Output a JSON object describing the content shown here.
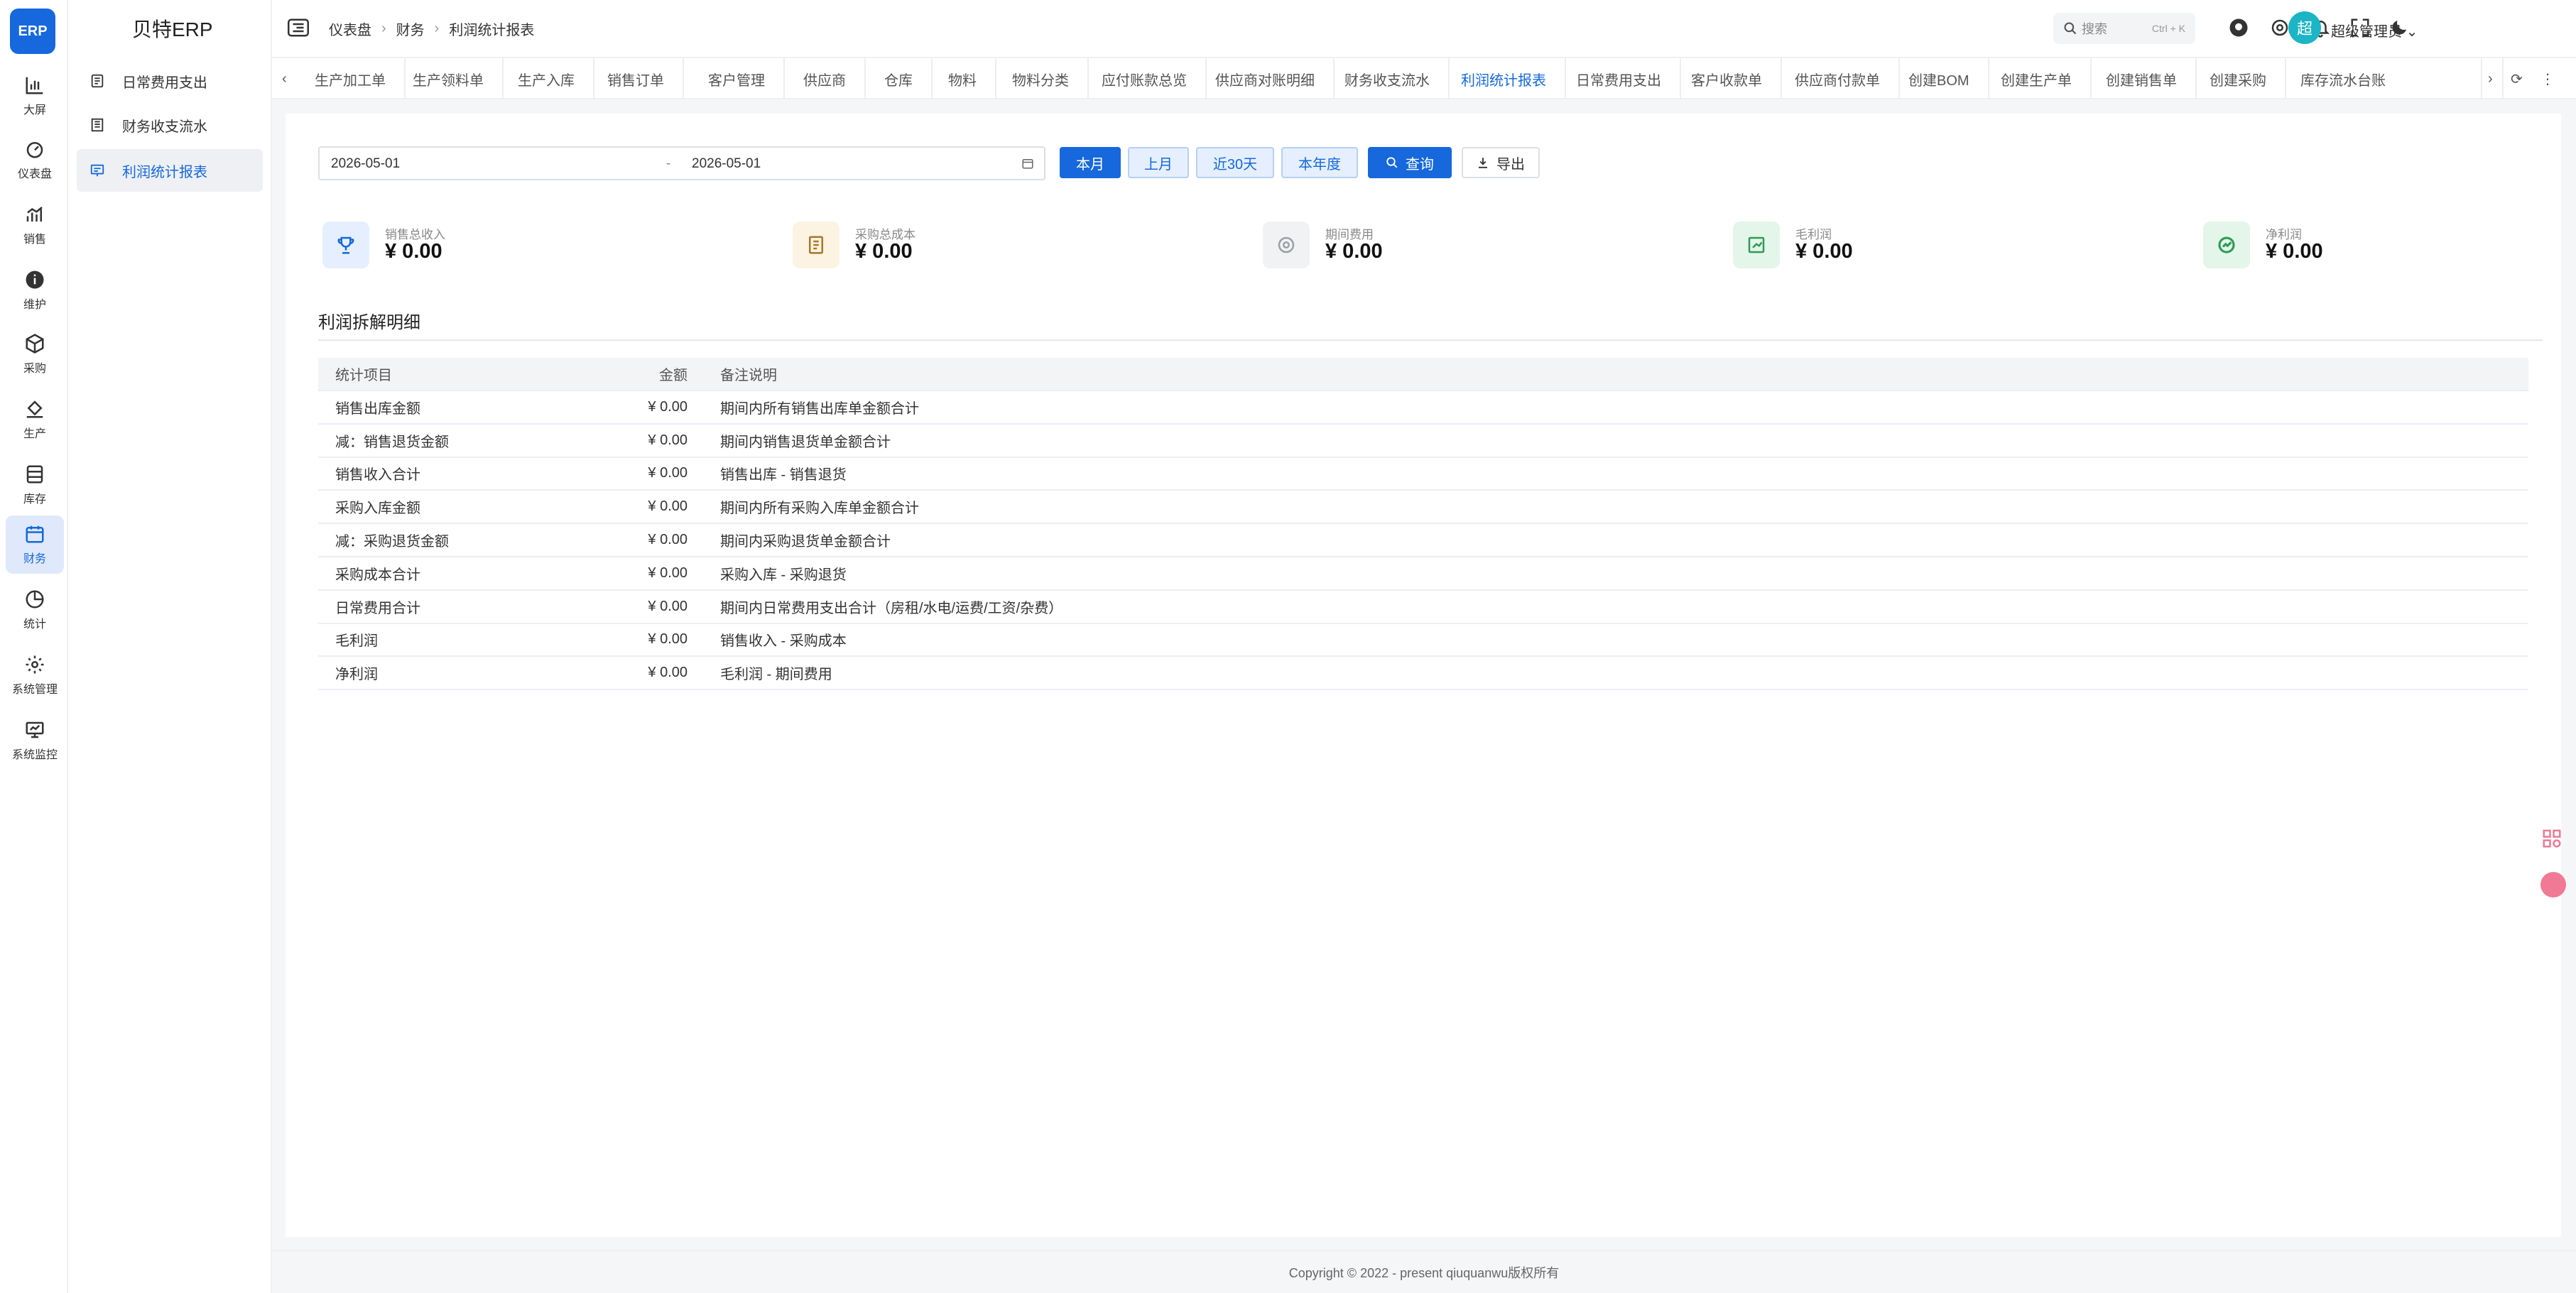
{
  "app": {
    "logo_text": "ERP",
    "brand": "贝特ERP"
  },
  "rail": [
    {
      "label": "大屏",
      "icon": "bar-chart-icon"
    },
    {
      "label": "仪表盘",
      "icon": "dashboard-icon"
    },
    {
      "label": "销售",
      "icon": "trend-chart-icon"
    },
    {
      "label": "维护",
      "icon": "info-icon"
    },
    {
      "label": "采购",
      "icon": "box-icon"
    },
    {
      "label": "生产",
      "icon": "paint-bucket-icon"
    },
    {
      "label": "库存",
      "icon": "storage-icon"
    },
    {
      "label": "财务",
      "icon": "calendar-icon"
    },
    {
      "label": "统计",
      "icon": "pie-chart-icon"
    },
    {
      "label": "系统管理",
      "icon": "gear-icon"
    },
    {
      "label": "系统监控",
      "icon": "monitor-icon"
    }
  ],
  "submenu": [
    {
      "label": "日常费用支出",
      "icon": "expense-icon"
    },
    {
      "label": "财务收支流水",
      "icon": "ledger-icon"
    },
    {
      "label": "利润统计报表",
      "icon": "report-icon"
    }
  ],
  "breadcrumb": [
    "仪表盘",
    "财务",
    "利润统计报表"
  ],
  "search": {
    "placeholder": "搜索",
    "shortcut": "Ctrl + K"
  },
  "user": {
    "avatar": "超",
    "name": "超级管理员"
  },
  "tabs": [
    "生产加工单",
    "生产领料单",
    "生产入库",
    "销售订单",
    "客户管理",
    "供应商",
    "仓库",
    "物料",
    "物料分类",
    "应付账款总览",
    "供应商对账明细",
    "财务收支流水",
    "利润统计报表",
    "日常费用支出",
    "客户收款单",
    "供应商付款单",
    "创建BOM",
    "创建生产单",
    "创建销售单",
    "创建采购",
    "库存流水台账"
  ],
  "active_tab": "利润统计报表",
  "filter": {
    "start_date": "2026-05-01",
    "separator": "-",
    "end_date": "2026-05-01",
    "quick": [
      "本月",
      "上月",
      "近30天",
      "本年度"
    ],
    "query": "查询",
    "export": "导出"
  },
  "stats": [
    {
      "label": "销售总收入",
      "value": "¥ 0.00",
      "icon": "trophy-icon",
      "color": "#1668dc",
      "bg": "#e6efff"
    },
    {
      "label": "采购总成本",
      "value": "¥ 0.00",
      "icon": "receipt-icon",
      "color": "#c58a2b",
      "bg": "#fdf3e3"
    },
    {
      "label": "期间费用",
      "value": "¥ 0.00",
      "icon": "coin-icon",
      "color": "#9aa0a6",
      "bg": "#f1f2f4"
    },
    {
      "label": "毛利润",
      "value": "¥ 0.00",
      "icon": "profit-icon",
      "color": "#2e9b55",
      "bg": "#e4f5ea"
    },
    {
      "label": "净利润",
      "value": "¥ 0.00",
      "icon": "growth-icon",
      "color": "#2e9b55",
      "bg": "#e4f5ea"
    }
  ],
  "detail": {
    "title": "利润拆解明细",
    "columns": [
      "统计项目",
      "金额",
      "备注说明"
    ],
    "rows": [
      [
        "销售出库金额",
        "¥ 0.00",
        "期间内所有销售出库单金额合计"
      ],
      [
        "减：销售退货金额",
        "¥ 0.00",
        "期间内销售退货单金额合计"
      ],
      [
        "销售收入合计",
        "¥ 0.00",
        "销售出库 - 销售退货"
      ],
      [
        "采购入库金额",
        "¥ 0.00",
        "期间内所有采购入库单金额合计"
      ],
      [
        "减：采购退货金额",
        "¥ 0.00",
        "期间内采购退货单金额合计"
      ],
      [
        "采购成本合计",
        "¥ 0.00",
        "采购入库 - 采购退货"
      ],
      [
        "日常费用合计",
        "¥ 0.00",
        "期间内日常费用支出合计（房租/水电/运费/工资/杂费）"
      ],
      [
        "毛利润",
        "¥ 0.00",
        "销售收入 - 采购成本"
      ],
      [
        "净利润",
        "¥ 0.00",
        "毛利润 - 期间费用"
      ]
    ]
  },
  "footer": "Copyright © 2022 - present qiuquanwu版权所有"
}
